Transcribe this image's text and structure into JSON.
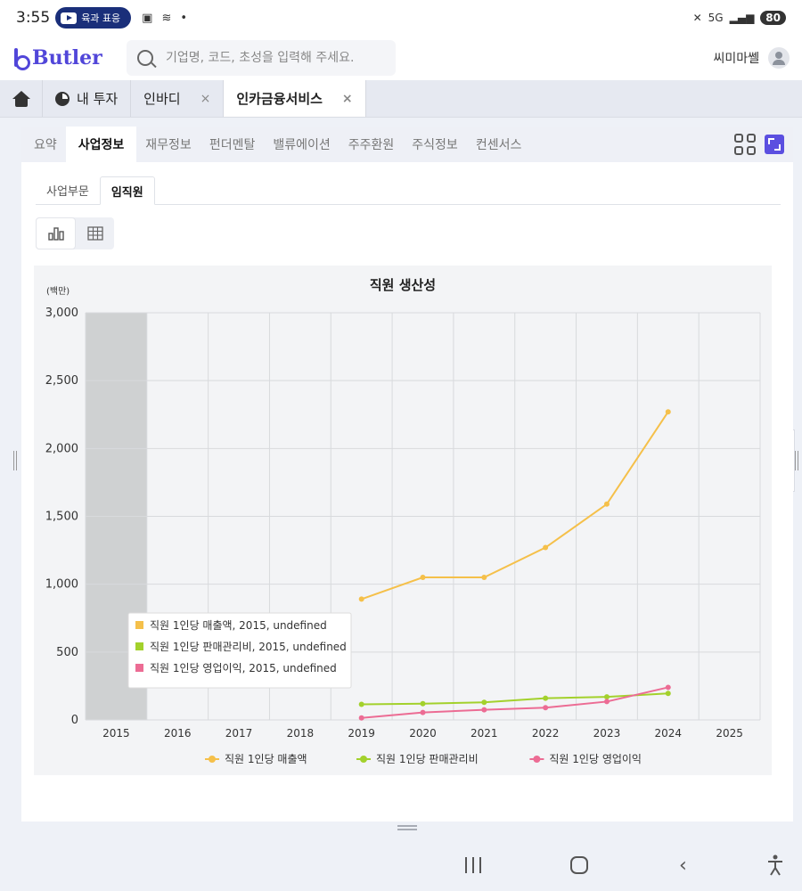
{
  "status_bar": {
    "time": "3:55",
    "notification_pill": "육과 표응",
    "network": "5G",
    "battery": "80"
  },
  "header": {
    "logo_text": "Butler",
    "search_placeholder": "기업명, 코드, 초성을 입력해 주세요.",
    "user_name": "씨미마쎌"
  },
  "top_tabs": [
    {
      "label": "내 투자",
      "icon": "pie-chart-icon"
    },
    {
      "label": "인바디",
      "closable": true
    },
    {
      "label": "인카금융서비스",
      "closable": true,
      "active": true
    }
  ],
  "close_glyph": "×",
  "subnav": [
    "요약",
    "사업정보",
    "재무정보",
    "펀더멘탈",
    "밸류에이션",
    "주주환원",
    "주식정보",
    "컨센서스"
  ],
  "subnav_active": "사업정보",
  "inner_tabs": [
    "사업부문",
    "임직원"
  ],
  "inner_active": "임직원",
  "view_toggle": [
    "bar-chart-icon",
    "table-icon"
  ],
  "side_handles": {
    "left_glyph": "›",
    "right_glyph": "‹"
  },
  "colors": {
    "accent": "#5146d9",
    "sales": "#f5c04a",
    "sga": "#a3d12c",
    "op_income": "#ec6c94",
    "highlight_band": "#cfd1d2"
  },
  "chart_data": {
    "type": "line",
    "title": "직원 생산성",
    "unit_label": "(백만)",
    "categories": [
      "2015",
      "2016",
      "2017",
      "2018",
      "2019",
      "2020",
      "2021",
      "2022",
      "2023",
      "2024",
      "2025"
    ],
    "ylim": [
      0,
      3000
    ],
    "yticks": [
      0,
      500,
      1000,
      1500,
      2000,
      2500,
      3000
    ],
    "ytick_labels": [
      "0",
      "500",
      "1,000",
      "1,500",
      "2,000",
      "2,500",
      "3,000"
    ],
    "grid": true,
    "highlighted_category": "2015",
    "series": [
      {
        "name": "직원 1인당 매출액",
        "color": "#f5c04a",
        "values": [
          null,
          null,
          null,
          null,
          890,
          1050,
          1050,
          1270,
          1590,
          2270,
          null
        ]
      },
      {
        "name": "직원 1인당 판매관리비",
        "color": "#a3d12c",
        "values": [
          null,
          null,
          null,
          null,
          115,
          120,
          130,
          160,
          170,
          195,
          null
        ]
      },
      {
        "name": "직원 1인당 영업이익",
        "color": "#ec6c94",
        "values": [
          null,
          null,
          null,
          null,
          15,
          55,
          75,
          90,
          135,
          240,
          null
        ]
      }
    ],
    "tooltip": {
      "lines": [
        "직원 1인당 매출액, 2015, undefined",
        "직원 1인당 판매관리비, 2015, undefined",
        "직원 1인당 영업이익, 2015, undefined"
      ]
    },
    "legend_position": "bottom"
  }
}
